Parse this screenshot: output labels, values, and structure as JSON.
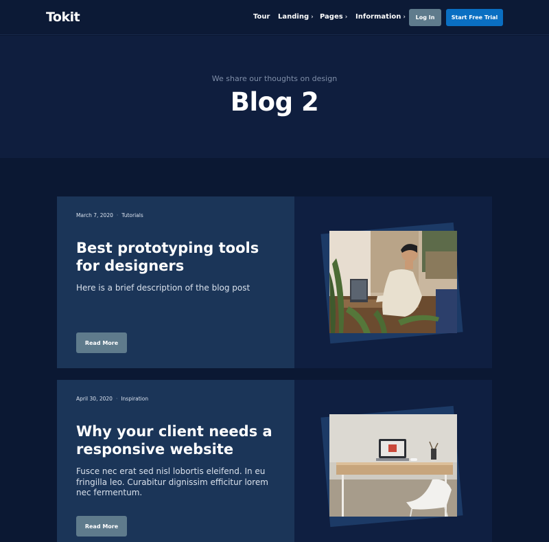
{
  "header": {
    "logo": "Tokit",
    "nav": [
      {
        "label": "Tour"
      },
      {
        "label": "Landing",
        "chevron": "›"
      },
      {
        "label": "Pages",
        "chevron": "›"
      },
      {
        "label": "Information",
        "chevron": "›"
      }
    ],
    "login_label": "Log In",
    "trial_label": "Start Free Trial"
  },
  "hero": {
    "subtitle": "We share our thoughts on design",
    "title": "Blog 2"
  },
  "posts": [
    {
      "date": "March 7, 2020",
      "separator": "·",
      "category": "Tutorials",
      "title": "Best prototyping tools for designers",
      "description": "Here is a brief description of the blog post",
      "button": "Read More"
    },
    {
      "date": "April 30, 2020",
      "separator": "·",
      "category": "Inspiration",
      "title": "Why your client needs a responsive website",
      "description": "Fusce nec erat sed nisl lobortis eleifend. In eu fringilla leo. Curabitur dignissim efficitur lorem nec fermentum.",
      "button": "Read More"
    }
  ],
  "colors": {
    "page_bg": "#0b1833",
    "hero_bg": "#0f1e3e",
    "card_left": "#1b3558",
    "card_right": "#0f1f41",
    "button_gray": "#5f7b8c",
    "button_blue": "#0a6fc2"
  }
}
